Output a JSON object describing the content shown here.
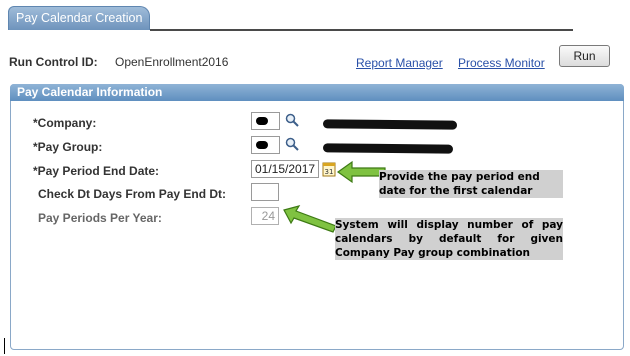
{
  "page": {
    "tab_label": "Pay Calendar Creation"
  },
  "run_control": {
    "label": "Run Control ID:",
    "value": "OpenEnrollment2016",
    "report_manager": "Report Manager",
    "process_monitor": "Process Monitor",
    "run_button": "Run"
  },
  "section": {
    "title": "Pay Calendar Information"
  },
  "fields": {
    "company_label": "*Company:",
    "pay_group_label": "*Pay Group:",
    "end_date_label": "*Pay Period End Date:",
    "end_date_value": "01/15/2017",
    "check_days_label": "Check Dt Days From Pay End Dt:",
    "check_days_value": "",
    "periods_label": "Pay Periods Per Year:",
    "periods_value": "24"
  },
  "annotations": {
    "end_date_note": "Provide the pay period end date for the first calendar",
    "periods_note": "System will display number of pay calendars by default for given Company Pay group combination",
    "arrow_color": "#7fc241"
  },
  "icons": {
    "lookup": "magnifier-icon",
    "calendar": "calendar-icon"
  }
}
